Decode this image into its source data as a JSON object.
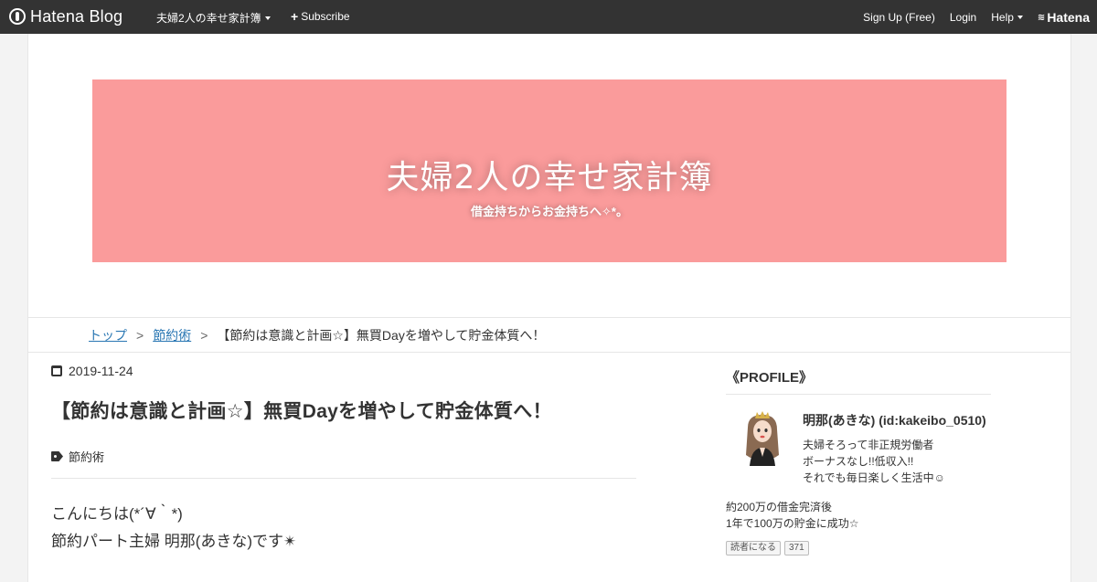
{
  "topbar": {
    "logo_text": "Hatena Blog",
    "blog_menu": "夫婦2人の幸せ家計簿",
    "subscribe": "Subscribe",
    "signup": "Sign Up (Free)",
    "login": "Login",
    "help": "Help",
    "hatena": "Hatena"
  },
  "header": {
    "title": "夫婦2人の幸せ家計簿",
    "description": "借金持ちからお金持ちへ✧*。",
    "banner_color": "#fa9b9b"
  },
  "breadcrumb": {
    "top": "トップ",
    "sep": ">",
    "category": "節約術",
    "current": "【節約は意識と計画☆】無買Dayを増やして貯金体質へ！"
  },
  "article": {
    "date": "2019-11-24",
    "title": "【節約は意識と計画☆】無買Dayを増やして貯金体質へ！",
    "category": "節約術",
    "body": [
      "こんにちは(*´∀｀*)",
      "節約パート主婦 明那(あきな)です✴"
    ]
  },
  "sidebar": {
    "heading": "《PROFILE》",
    "name": "明那(あきな) (id:kakeibo_0510)",
    "desc": [
      "夫婦そろって非正規労働者",
      "ボーナスなし!!低収入!!",
      "それでも毎日楽しく生活中☺"
    ],
    "text": [
      "約200万の借金完済後",
      "1年で100万の貯金に成功☆"
    ],
    "button_1": "読者になる",
    "button_2": "371"
  }
}
